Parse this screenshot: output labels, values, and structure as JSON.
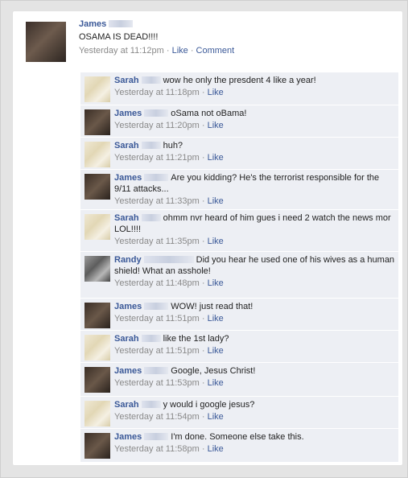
{
  "post": {
    "author": "James",
    "text": "OSAMA IS DEAD!!!!",
    "time": "Yesterday at 11:12pm",
    "sep1": " · ",
    "like": "Like",
    "sep2": " · ",
    "comment": "Comment"
  },
  "comments": [
    {
      "author": "Sarah",
      "text": "wow he only the presdent 4 like a year!",
      "time": "Yesterday at 11:18pm",
      "like": "Like"
    },
    {
      "author": "James",
      "text": "oSama not oBama!",
      "time": "Yesterday at 11:20pm",
      "like": "Like"
    },
    {
      "author": "Sarah",
      "text": "huh?",
      "time": "Yesterday at 11:21pm",
      "like": "Like"
    },
    {
      "author": "James",
      "text": "Are you kidding? He's the terrorist responsible for the 9/11 attacks...",
      "time": "Yesterday at 11:33pm",
      "like": "Like"
    },
    {
      "author": "Sarah",
      "text": "ohmm nvr heard of him gues i need 2 watch the news mor LOL!!!!",
      "time": "Yesterday at 11:35pm",
      "like": "Like"
    },
    {
      "author": "Randy",
      "text": "Did you hear he used one of his wives as a human shield! What an asshole!",
      "time": "Yesterday at 11:48pm",
      "like": "Like"
    },
    {
      "author": "James",
      "text": "WOW! just read that!",
      "time": "Yesterday at 11:51pm",
      "like": "Like"
    },
    {
      "author": "Sarah",
      "text": "like the 1st lady?",
      "time": "Yesterday at 11:51pm",
      "like": "Like"
    },
    {
      "author": "James",
      "text": "Google, Jesus Christ!",
      "time": "Yesterday at 11:53pm",
      "like": "Like"
    },
    {
      "author": "Sarah",
      "text": "y would i google jesus?",
      "time": "Yesterday at 11:54pm",
      "like": "Like"
    },
    {
      "author": "James",
      "text": "I'm done. Someone else take this.",
      "time": "Yesterday at 11:58pm",
      "like": "Like"
    }
  ]
}
